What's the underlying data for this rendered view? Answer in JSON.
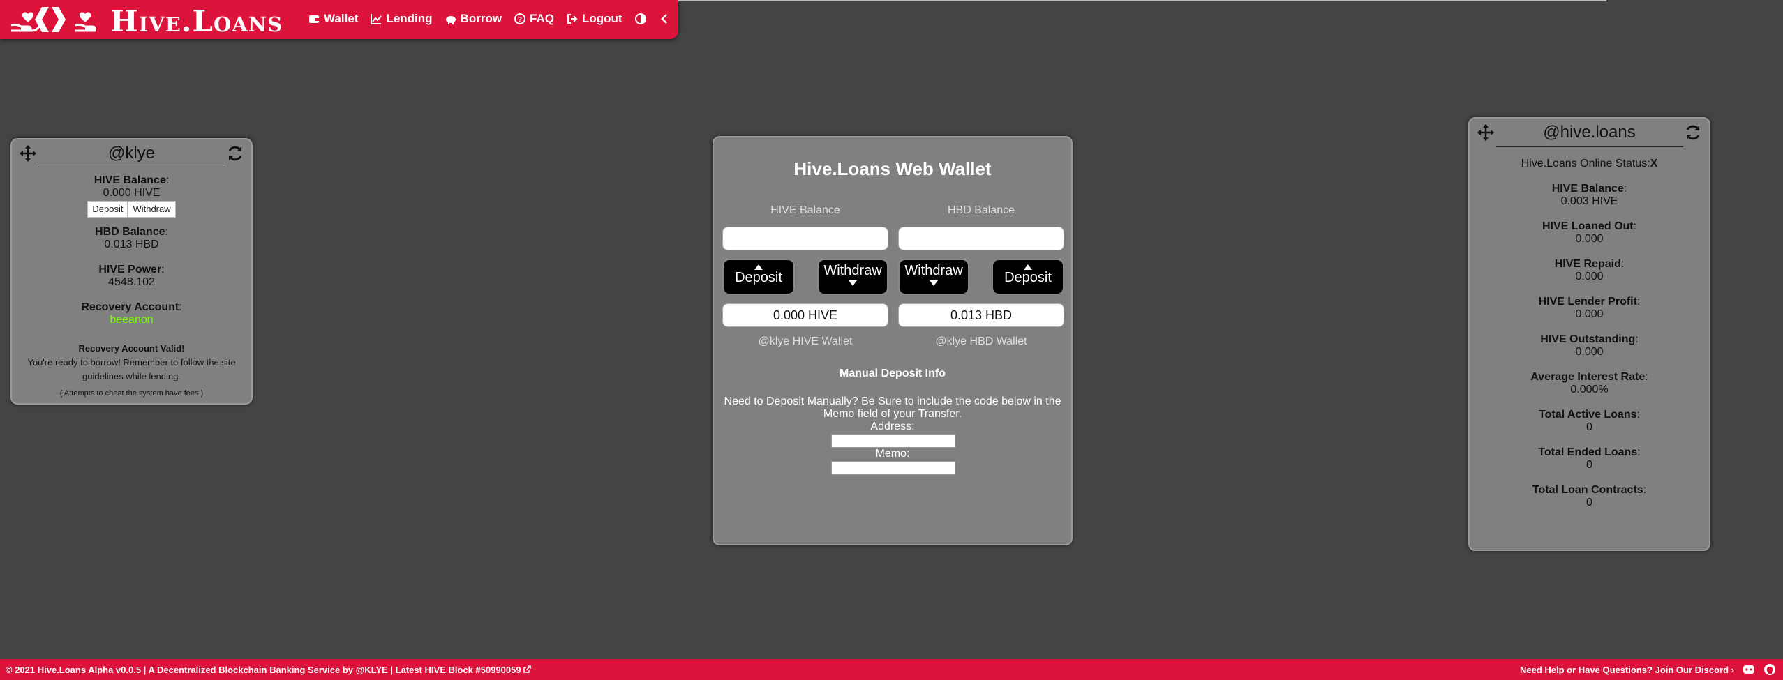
{
  "brand": {
    "name": "Hive.Loans"
  },
  "nav": {
    "items": [
      {
        "label": "Wallet",
        "icon": "wallet-icon"
      },
      {
        "label": "Lending",
        "icon": "chart-icon"
      },
      {
        "label": "Borrow",
        "icon": "piggy-bank-icon"
      },
      {
        "label": "FAQ",
        "icon": "question-icon"
      },
      {
        "label": "Logout",
        "icon": "logout-icon"
      }
    ]
  },
  "user_panel": {
    "title": "@klye",
    "hive_balance_label": "HIVE Balance",
    "hive_balance_value": "0.000 HIVE",
    "deposit_label": "Deposit",
    "withdraw_label": "Withdraw",
    "hbd_balance_label": "HBD Balance",
    "hbd_balance_value": "0.013 HBD",
    "hive_power_label": "HIVE Power",
    "hive_power_value": "4548.102",
    "recovery_label": "Recovery Account",
    "recovery_value": "beeanon",
    "valid_title": "Recovery Account Valid!",
    "valid_line1": "You're ready to borrow! Remember to follow the site",
    "valid_line2": "guidelines while lending.",
    "cheat_note": "( Attempts to cheat the system have fees )",
    "colors": {
      "recovery_value": "#7cfc00"
    }
  },
  "wallet": {
    "title": "Hive.Loans Web Wallet",
    "hive_balance_label": "HIVE Balance",
    "hbd_balance_label": "HBD Balance",
    "deposit_label": "Deposit",
    "withdraw_label": "Withdraw",
    "hive_value": "0.000 HIVE",
    "hbd_value": "0.013 HBD",
    "hive_wallet_caption": "@klye HIVE Wallet",
    "hbd_wallet_caption": "@klye HBD Wallet",
    "manual_title": "Manual Deposit Info",
    "manual_line1": "Need to Deposit Manually? Be Sure to include the code below in the",
    "manual_line2": "Memo field of your Transfer.",
    "address_label": "Address:",
    "memo_label": "Memo:"
  },
  "site_panel": {
    "title": "@hive.loans",
    "online_label": "Hive.Loans Online Status:",
    "online_value": "X",
    "stats": [
      {
        "label": "HIVE Balance",
        "value": "0.003 HIVE"
      },
      {
        "label": "HIVE Loaned Out",
        "value": "0.000"
      },
      {
        "label": "HIVE Repaid",
        "value": "0.000"
      },
      {
        "label": "HIVE Lender Profit",
        "value": "0.000"
      },
      {
        "label": "HIVE Outstanding",
        "value": "0.000"
      },
      {
        "label": "Average Interest Rate",
        "value": "0.000%"
      },
      {
        "label": "Total Active Loans",
        "value": "0"
      },
      {
        "label": "Total Ended Loans",
        "value": "0"
      },
      {
        "label": "Total Loan Contracts",
        "value": "0"
      }
    ]
  },
  "footer": {
    "left": "© 2021 Hive.Loans Alpha v0.0.5 | A Decentralized Blockchain Banking Service by @KLYE | Latest HIVE Block #50990059",
    "right": "Need Help or Have Questions? Join Our Discord ›"
  },
  "colors": {
    "brand_red": "#dc143c",
    "background": "#444444",
    "panel": "#808080"
  }
}
